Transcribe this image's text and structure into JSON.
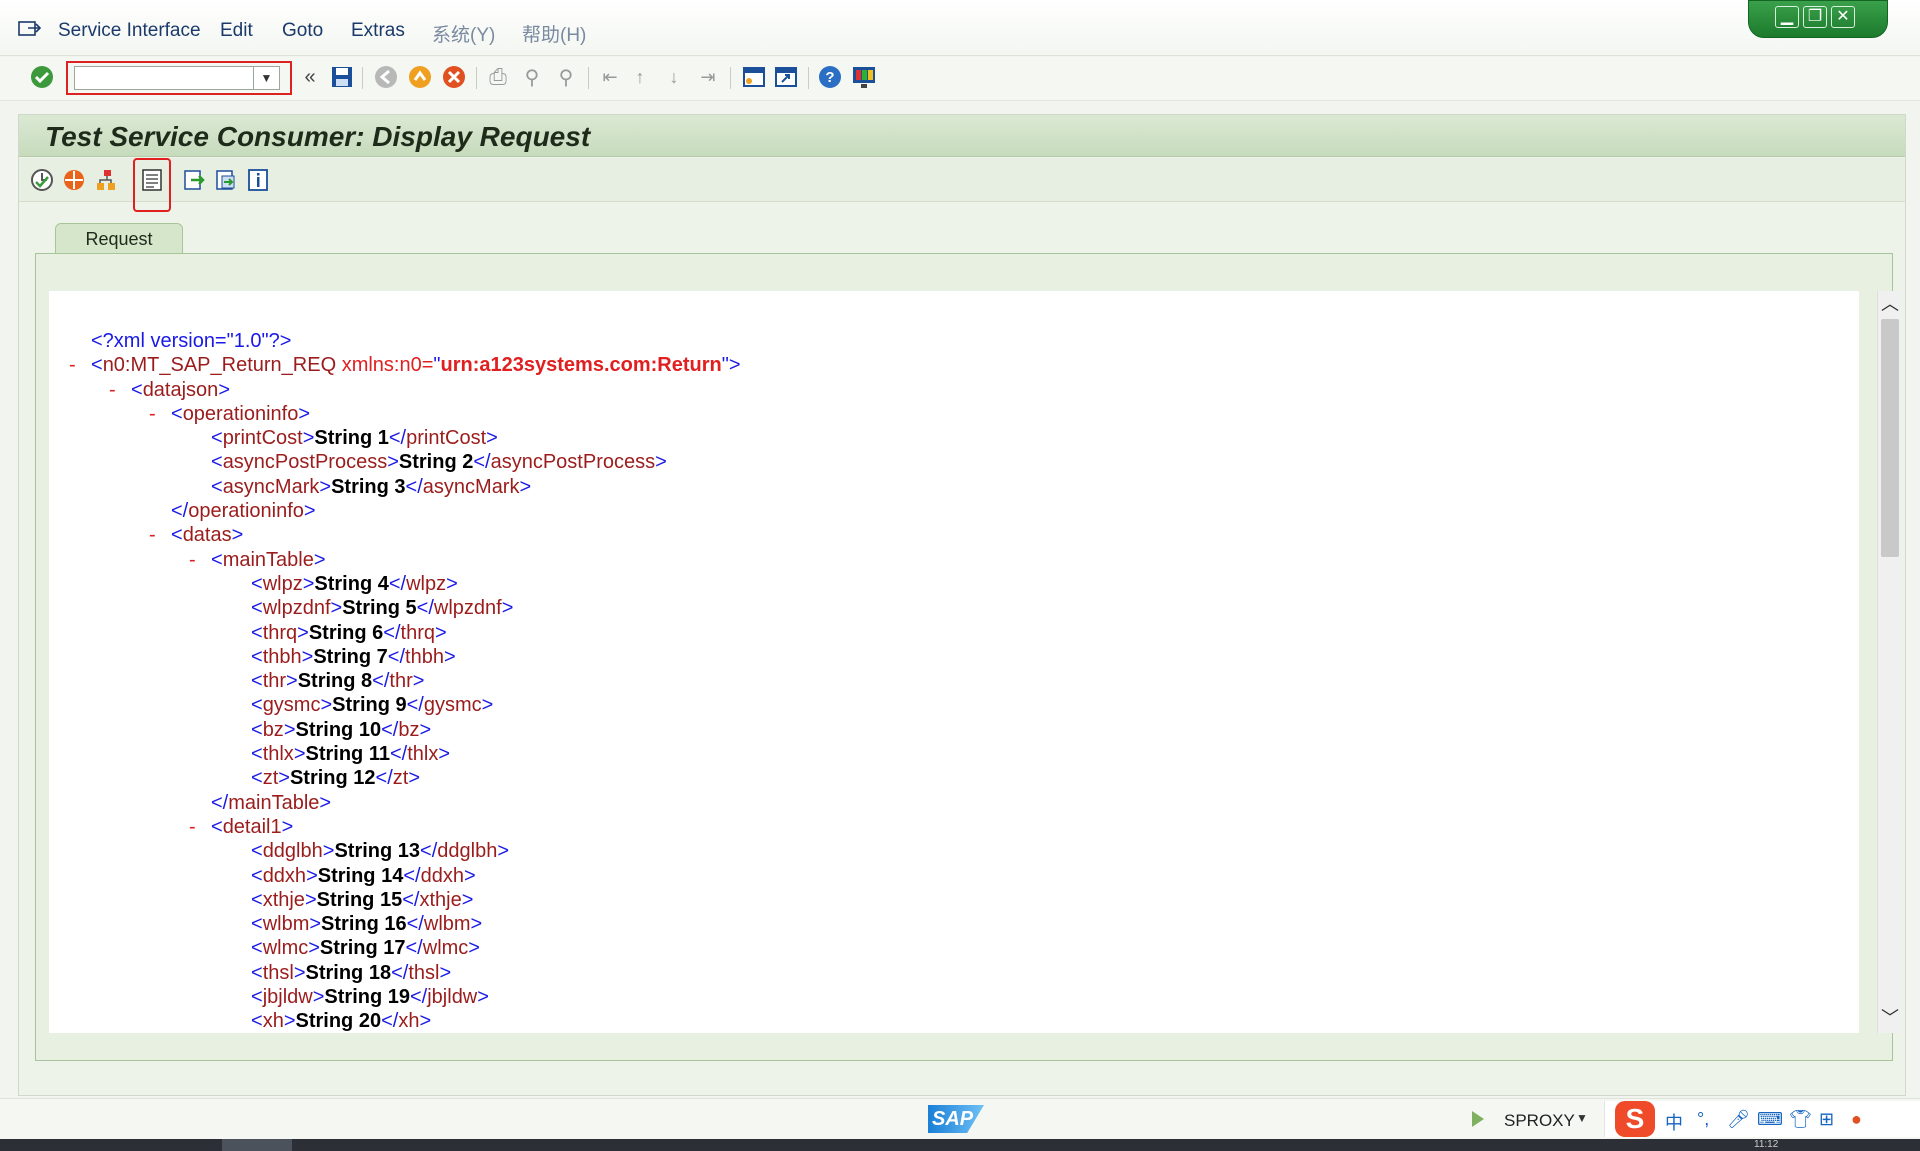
{
  "menu": {
    "items": [
      "Service Interface",
      "Edit",
      "Goto",
      "Extras",
      "系统(Y)",
      "帮助(H)"
    ]
  },
  "system_toolbar": {
    "command_field_value": "",
    "icons": [
      "enter-icon",
      "back-nav-icon",
      "save-icon",
      "back-icon",
      "exit-icon",
      "cancel-icon",
      "print-icon",
      "find-icon",
      "find-next-icon",
      "first-page-icon",
      "prev-page-icon",
      "next-page-icon",
      "last-page-icon",
      "new-session-icon",
      "shortcut-icon",
      "help-icon",
      "layout-icon"
    ]
  },
  "screen": {
    "title": "Test Service Consumer: Display Request"
  },
  "tabs": [
    {
      "label": "Request"
    }
  ],
  "xml": {
    "pi": "<?xml version=\"1.0\"?>",
    "root_tag": "n0:MT_SAP_Return_REQ",
    "root_attr": "xmlns:n0=",
    "root_attr_value": "urn:a123systems.com:Return",
    "datajson": "datajson",
    "operationinfo": "operationinfo",
    "datas": "datas",
    "mainTable": "mainTable",
    "detail1": "detail1",
    "operation_fields": [
      {
        "tag": "printCost",
        "value": "String 1"
      },
      {
        "tag": "asyncPostProcess",
        "value": "String 2"
      },
      {
        "tag": "asyncMark",
        "value": "String 3"
      }
    ],
    "main_fields": [
      {
        "tag": "wlpz",
        "value": "String 4"
      },
      {
        "tag": "wlpzdnf",
        "value": "String 5"
      },
      {
        "tag": "thrq",
        "value": "String 6"
      },
      {
        "tag": "thbh",
        "value": "String 7"
      },
      {
        "tag": "thr",
        "value": "String 8"
      },
      {
        "tag": "gysmc",
        "value": "String 9"
      },
      {
        "tag": "bz",
        "value": "String 10"
      },
      {
        "tag": "thlx",
        "value": "String 11"
      },
      {
        "tag": "zt",
        "value": "String 12"
      }
    ],
    "detail_fields": [
      {
        "tag": "ddglbh",
        "value": "String 13"
      },
      {
        "tag": "ddxh",
        "value": "String 14"
      },
      {
        "tag": "xthje",
        "value": "String 15"
      },
      {
        "tag": "wlbm",
        "value": "String 16"
      },
      {
        "tag": "wlmc",
        "value": "String 17"
      },
      {
        "tag": "thsl",
        "value": "String 18"
      },
      {
        "tag": "jbjldw",
        "value": "String 19"
      },
      {
        "tag": "xh",
        "value": "String 20"
      }
    ]
  },
  "status": {
    "sap_logo": "SAP",
    "system": "SPROXY",
    "ime_logo": "S",
    "ime_mode": "中",
    "ime_punct": "°,",
    "clock": "11:12"
  },
  "colors": {
    "tag": "#9b1c1c",
    "bracket": "#1a1ae6",
    "attr": "#e02020",
    "title_bg": "#c7dbbc"
  }
}
